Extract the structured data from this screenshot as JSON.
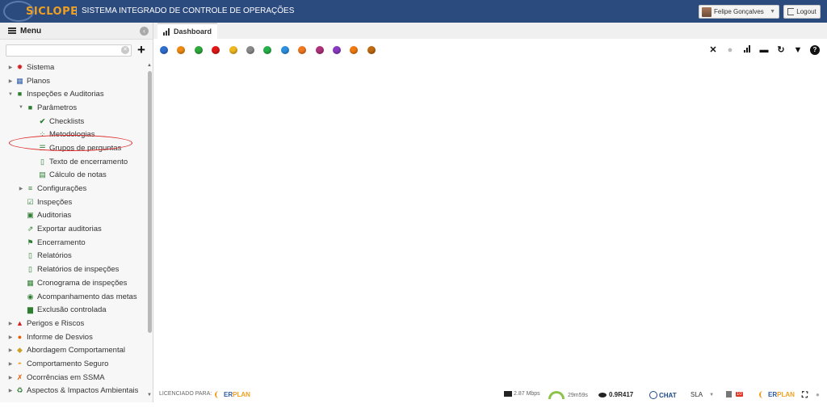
{
  "header": {
    "logo_text": "SICLOPE",
    "system_title": "SISTEMA INTEGRADO DE CONTROLE DE OPERAÇÕES",
    "user_name": "Felipe Gonçalves",
    "logout_label": "Logout"
  },
  "sidebar": {
    "menu_label": "Menu",
    "search_placeholder": "",
    "items": [
      {
        "label": "Sistema",
        "icon": "gear-icon",
        "color": "#d02020"
      },
      {
        "label": "Planos",
        "icon": "calendar-icon",
        "color": "#2b5aa8"
      },
      {
        "label": "Inspeções e Auditorias",
        "icon": "folder-icon",
        "color": "#2e7d32"
      },
      {
        "label": "Parâmetros",
        "icon": "folder-open-icon",
        "color": "#2e7d32"
      },
      {
        "label": "Checklists",
        "icon": "check-icon",
        "color": "#2e7d32"
      },
      {
        "label": "Metodologias",
        "icon": "nodes-icon",
        "color": "#2e7d32"
      },
      {
        "label": "Grupos de perguntas",
        "icon": "list-icon",
        "color": "#2e7d32"
      },
      {
        "label": "Texto de encerramento",
        "icon": "book-icon",
        "color": "#2e7d32"
      },
      {
        "label": "Cálculo de notas",
        "icon": "chart-icon",
        "color": "#2e7d32"
      },
      {
        "label": "Configurações",
        "icon": "sliders-icon",
        "color": "#2e7d32"
      },
      {
        "label": "Inspeções",
        "icon": "clipboard-check-icon",
        "color": "#2e7d32"
      },
      {
        "label": "Auditorias",
        "icon": "clipboard-icon",
        "color": "#2e7d32"
      },
      {
        "label": "Exportar auditorias",
        "icon": "export-icon",
        "color": "#2e7d32"
      },
      {
        "label": "Encerramento",
        "icon": "flag-icon",
        "color": "#2e7d32"
      },
      {
        "label": "Relatórios",
        "icon": "pdf-icon",
        "color": "#2e7d32"
      },
      {
        "label": "Relatórios de inspeções",
        "icon": "pdf-icon",
        "color": "#2e7d32"
      },
      {
        "label": "Cronograma de inspeções",
        "icon": "calendar-grid-icon",
        "color": "#2e7d32"
      },
      {
        "label": "Acompanhamento das metas",
        "icon": "target-icon",
        "color": "#2e7d32"
      },
      {
        "label": "Exclusão controlada",
        "icon": "trash-icon",
        "color": "#2e7d32"
      },
      {
        "label": "Perigos e Riscos",
        "icon": "warning-icon",
        "color": "#d02020"
      },
      {
        "label": "Informe de Desvios",
        "icon": "phone-icon",
        "color": "#e65c00"
      },
      {
        "label": "Abordagem Comportamental",
        "icon": "diamond-icon",
        "color": "#c9a227"
      },
      {
        "label": "Comportamento Seguro",
        "icon": "helmet-icon",
        "color": "#f0a020"
      },
      {
        "label": "Ocorrências em SSMA",
        "icon": "person-fall-icon",
        "color": "#e65c00"
      },
      {
        "label": "Aspectos & Impactos Ambientais",
        "icon": "recycle-icon",
        "color": "#2e7d32"
      }
    ]
  },
  "tabs": {
    "dashboard_label": "Dashboard"
  },
  "toolbar": {
    "dot_colors": [
      "#2f6fd0",
      "#f08a10",
      "#2eaa3c",
      "#e01818",
      "#f0b820",
      "#8a8a8a",
      "#28b04a",
      "#2c8fe0",
      "#f07820",
      "#b0307a",
      "#8a3ac0",
      "#f07a10",
      "#c06a10"
    ],
    "right_icons": [
      "close-icon",
      "circle-icon",
      "bars-icon",
      "pulse-icon",
      "refresh-icon",
      "filter-icon",
      "help-icon"
    ]
  },
  "statusbar": {
    "licensed_label": "LICENCIADO PARA:",
    "brand_er": "ER",
    "brand_plan": "PLAN",
    "speed": "2.87 Mbps",
    "time": "29m59s",
    "version": "0.9R417",
    "chat": "CHAT",
    "sla": "SLA",
    "badge": "10"
  }
}
